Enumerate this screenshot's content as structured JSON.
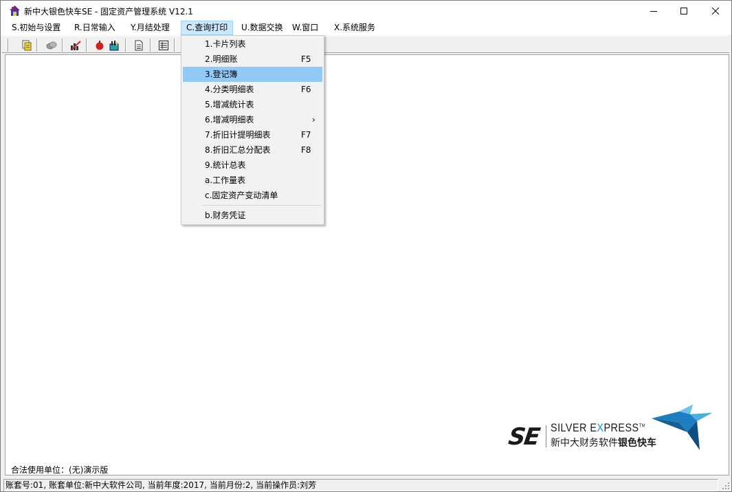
{
  "window": {
    "title": "新中大银色快车SE - 固定资产管理系统 V12.1",
    "controls": {
      "minimize": "—",
      "maximize": "☐",
      "close": "✕"
    }
  },
  "menubar": {
    "items": [
      {
        "label": "S.初始与设置"
      },
      {
        "label": "R.日常输入"
      },
      {
        "label": "Y.月结处理"
      },
      {
        "label": "C.查询打印"
      },
      {
        "label": "U.数据交换"
      },
      {
        "label": "W.窗口"
      },
      {
        "label": "X.系统服务"
      }
    ],
    "active_index": 3
  },
  "toolbar": {
    "buttons": [
      {
        "icon": "copy-documents-icon"
      },
      {
        "icon": "coins-icon"
      },
      {
        "icon": "edit-chart-icon"
      },
      {
        "icon": "apple-icon"
      },
      {
        "icon": "chart-basket-icon"
      },
      {
        "icon": "document-icon"
      },
      {
        "icon": "report-sheet-icon"
      }
    ]
  },
  "dropdown": {
    "items": [
      {
        "label": "1.卡片列表",
        "shortcut": ""
      },
      {
        "label": "2.明细账",
        "shortcut": "F5"
      },
      {
        "label": "3.登记簿",
        "shortcut": "",
        "highlighted": true
      },
      {
        "label": "4.分类明细表",
        "shortcut": "F6"
      },
      {
        "label": "5.增减统计表",
        "shortcut": ""
      },
      {
        "label": "6.增减明细表",
        "shortcut": "",
        "submenu": true
      },
      {
        "label": "7.折旧计提明细表",
        "shortcut": "F7"
      },
      {
        "label": "8.折旧汇总分配表",
        "shortcut": "F8"
      },
      {
        "label": "9.统计总表",
        "shortcut": ""
      },
      {
        "label": "a.工作量表",
        "shortcut": ""
      },
      {
        "label": "c.固定资产变动清单",
        "shortcut": ""
      },
      {
        "label": "b.财务凭证",
        "shortcut": ""
      }
    ],
    "submenu_arrow": "›"
  },
  "client": {
    "legal_unit": "合法使用单位：(无)演示版"
  },
  "logo": {
    "mark": "SE",
    "english_pre": "SILVER E",
    "english_x": "X",
    "english_post": "PRESS",
    "tm": "TM",
    "chinese_regular": "新中大财务软件",
    "chinese_bold": "银色快车"
  },
  "statusbar": {
    "text": "账套号:01, 账套单位:新中大软件公司, 当前年度:2017, 当前月份:2, 当前操作员:刘芳"
  },
  "colors": {
    "highlight": "#91c9f7",
    "menu_active": "#cce8ff",
    "logo_blue": "#1a8fd0"
  }
}
